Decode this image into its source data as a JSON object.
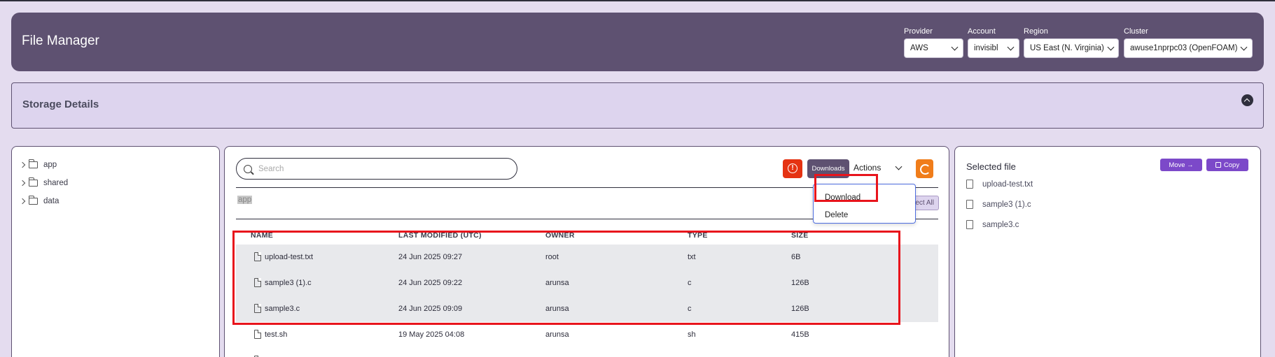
{
  "header": {
    "title": "File Manager",
    "provider": {
      "label": "Provider",
      "value": "AWS"
    },
    "account": {
      "label": "Account",
      "value": "invisibl"
    },
    "region": {
      "label": "Region",
      "value": "US East (N. Virginia)"
    },
    "cluster": {
      "label": "Cluster",
      "value": "awuse1nprpc03 (OpenFOAM)"
    }
  },
  "storage": {
    "title": "Storage Details",
    "collapse_icon": "chevron-up-circle-icon"
  },
  "tree": {
    "items": [
      {
        "label": "app"
      },
      {
        "label": "shared"
      },
      {
        "label": "data"
      }
    ]
  },
  "toolbar": {
    "search_placeholder": "Search",
    "alert_icon": "alert-circle-icon",
    "downloads_label": "Downloads",
    "actions_label": "Actions",
    "refresh_icon": "refresh-icon"
  },
  "breadcrumb": "app",
  "select_all_label": "ect All",
  "actions_menu": {
    "items": [
      "Download",
      "Delete"
    ]
  },
  "table": {
    "columns": [
      "NAME",
      "LAST MODIFIED (UTC)",
      "OWNER",
      "TYPE",
      "SIZE"
    ],
    "rows": [
      {
        "name": "upload-test.txt",
        "modified": "24 Jun 2025 09:27",
        "owner": "root",
        "type": "txt",
        "size": "6B",
        "selected": true
      },
      {
        "name": "sample3 (1).c",
        "modified": "24 Jun 2025 09:22",
        "owner": "arunsa",
        "type": "c",
        "size": "126B",
        "selected": true
      },
      {
        "name": "sample3.c",
        "modified": "24 Jun 2025 09:09",
        "owner": "arunsa",
        "type": "c",
        "size": "126B",
        "selected": true
      },
      {
        "name": "test.sh",
        "modified": "19 May 2025 04:08",
        "owner": "arunsa",
        "type": "sh",
        "size": "415B",
        "selected": false
      }
    ]
  },
  "selected_panel": {
    "title": "Selected file",
    "move_label": "Move →",
    "copy_label": "Copy",
    "files": [
      "upload-test.txt",
      "sample3 (1).c",
      "sample3.c"
    ]
  },
  "colors": {
    "header": "#5e5171",
    "accent": "#7c49c9",
    "alert": "#e53212",
    "refresh": "#f07d1a",
    "highlight": "#e8141c"
  }
}
